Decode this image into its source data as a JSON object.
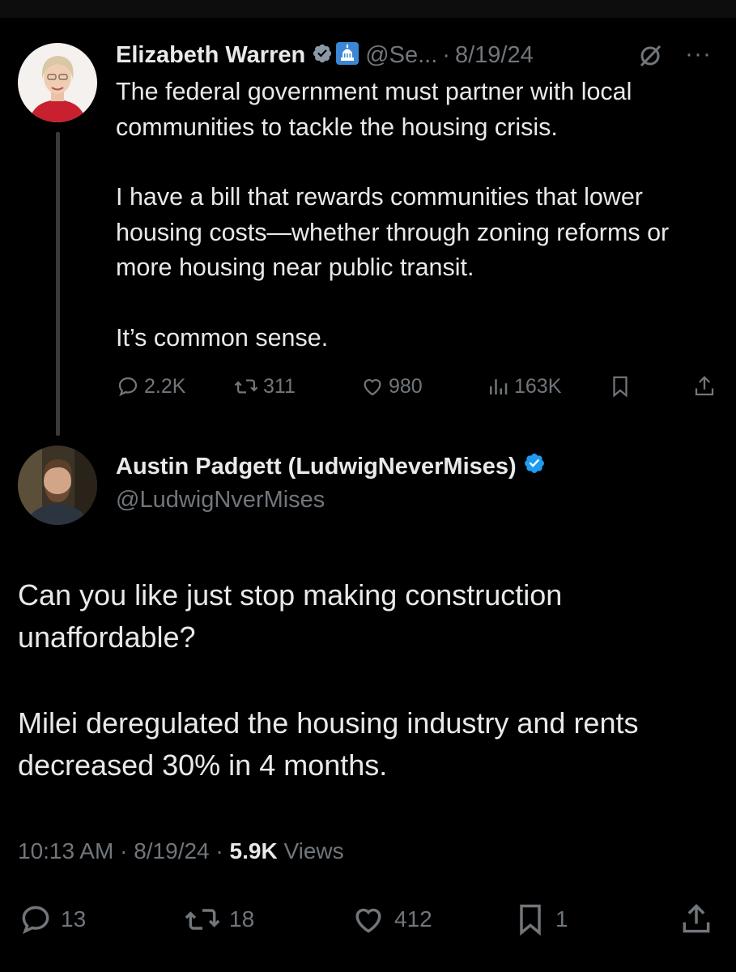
{
  "parent_tweet": {
    "author_name": "Elizabeth Warren",
    "handle": "@Se...",
    "separator": "·",
    "date": "8/19/24",
    "more": "···",
    "paragraphs": [
      "The federal government must partner with local communities to tackle the housing crisis.",
      "I have a bill that rewards communities that lower housing costs—whether through zoning reforms or more housing near public transit.",
      "It’s common sense."
    ],
    "metrics": {
      "replies": "2.2K",
      "reposts": "311",
      "likes": "980",
      "views": "163K"
    }
  },
  "reply_tweet": {
    "author_name": "Austin Padgett (LudwigNeverMises)",
    "handle": "@LudwigNverMises",
    "paragraphs": [
      "Can you like just stop making construction unaffordable?",
      "Milei deregulated the housing industry and rents decreased 30% in 4 months."
    ],
    "time": "10:13 AM",
    "sep": "·",
    "date": "8/19/24",
    "views_count": "5.9K",
    "views_label": "Views",
    "actions": {
      "replies": "13",
      "reposts": "18",
      "likes": "412",
      "bookmarks": "1"
    }
  },
  "icons": [
    "verified-badge-icon",
    "capitol-icon",
    "grok-icon",
    "reply-icon",
    "repost-icon",
    "like-icon",
    "views-icon",
    "bookmark-icon",
    "share-icon"
  ],
  "colors": {
    "background": "#000000",
    "text": "#e7e9ea",
    "muted": "#71767b",
    "verified": "#1d9bf0"
  }
}
